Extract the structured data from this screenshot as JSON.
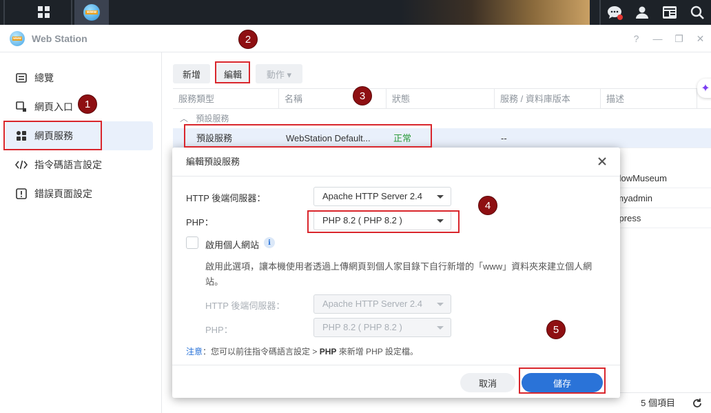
{
  "taskbar": {
    "wws_label": "www"
  },
  "window": {
    "title": "Web Station",
    "logo_label": "www",
    "controls": [
      "?",
      "—",
      "❐",
      "✕"
    ]
  },
  "sidebar": {
    "items": [
      {
        "label": "總覽",
        "icon": "overview-icon"
      },
      {
        "label": "網頁入口",
        "icon": "portal-icon"
      },
      {
        "label": "網頁服務",
        "icon": "service-icon"
      },
      {
        "label": "指令碼語言設定",
        "icon": "code-icon"
      },
      {
        "label": "錯誤頁面設定",
        "icon": "error-page-icon"
      }
    ]
  },
  "toolbar": {
    "new_label": "新增",
    "edit_label": "編輯",
    "action_label": "動作 ▾"
  },
  "grid": {
    "columns": [
      "服務類型",
      "名稱",
      "狀態",
      "服務 / 資料庫版本",
      "描述"
    ],
    "group_label": "預設服務",
    "group_chevron": "︿",
    "rows": [
      {
        "type": "預設服務",
        "name": "WebStation Default...",
        "status": "正常",
        "version": "--",
        "desc": ""
      },
      {
        "type": "",
        "name": "",
        "status": "",
        "version": "",
        "desc": "adowMuseum"
      },
      {
        "type": "",
        "name": "",
        "status": "",
        "version": "",
        "desc": "pmyadmin"
      },
      {
        "type": "",
        "name": "",
        "status": "",
        "version": "",
        "desc": "rdpress"
      }
    ],
    "footer_count": "5 個項目"
  },
  "modal": {
    "title": "編輯預設服務",
    "http_label": "HTTP 後端伺服器：",
    "http_value": "Apache HTTP Server 2.4",
    "php_label": "PHP：",
    "php_value": "PHP 8.2 ( PHP 8.2 )",
    "personal_label": "啟用個人網站",
    "info_glyph": "i",
    "personal_desc": "啟用此選項，讓本機使用者透過上傳網頁到個人家目錄下自行新增的「www」資料夾來建立個人網站。",
    "personal_http_label": "HTTP 後端伺服器：",
    "personal_http_value": "Apache HTTP Server 2.4",
    "personal_php_label": "PHP：",
    "personal_php_value": "PHP 8.2 ( PHP 8.2 )",
    "note_prefix": "注意",
    "note_text_1": "：您可以前往指令碼語言設定 > ",
    "note_bold": "PHP",
    "note_text_2": " 來新增 PHP 設定檔。",
    "cancel_label": "取消",
    "save_label": "儲存"
  },
  "annotations": {
    "step1": "1",
    "step2": "2",
    "step3": "3",
    "step4": "4",
    "step5": "5"
  }
}
